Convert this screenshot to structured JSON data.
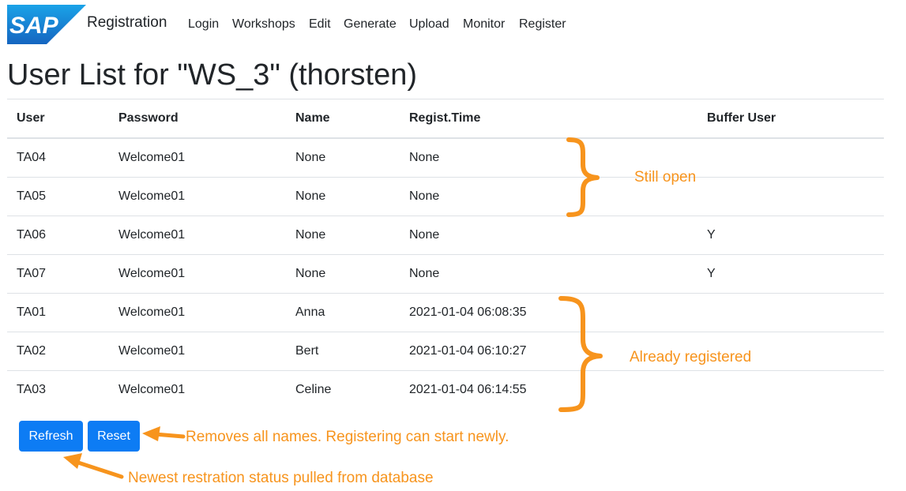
{
  "navbar": {
    "logo_text": "SAP",
    "brand": "Registration",
    "items": [
      "Login",
      "Workshops",
      "Edit",
      "Generate",
      "Upload",
      "Monitor",
      "Register"
    ]
  },
  "page": {
    "title": "User List for \"WS_3\" (thorsten)"
  },
  "table": {
    "headers": [
      "User",
      "Password",
      "Name",
      "Regist.Time",
      "Buffer User"
    ],
    "rows": [
      [
        "TA04",
        "Welcome01",
        "None",
        "None",
        ""
      ],
      [
        "TA05",
        "Welcome01",
        "None",
        "None",
        ""
      ],
      [
        "TA06",
        "Welcome01",
        "None",
        "None",
        "Y"
      ],
      [
        "TA07",
        "Welcome01",
        "None",
        "None",
        "Y"
      ],
      [
        "TA01",
        "Welcome01",
        "Anna",
        "2021-01-04 06:08:35",
        ""
      ],
      [
        "TA02",
        "Welcome01",
        "Bert",
        "2021-01-04 06:10:27",
        ""
      ],
      [
        "TA03",
        "Welcome01",
        "Celine",
        "2021-01-04 06:14:55",
        ""
      ]
    ]
  },
  "buttons": {
    "refresh": "Refresh",
    "reset": "Reset"
  },
  "annotations": {
    "still_open": "Still open",
    "already_registered": "Already registered",
    "reset_note": "Removes all names. Registering can start newly.",
    "refresh_note": "Newest restration status pulled from database"
  },
  "colors": {
    "primary": "#0d7cf4",
    "annotation": "#f7941d",
    "sap_logo": "#1a73c8"
  }
}
